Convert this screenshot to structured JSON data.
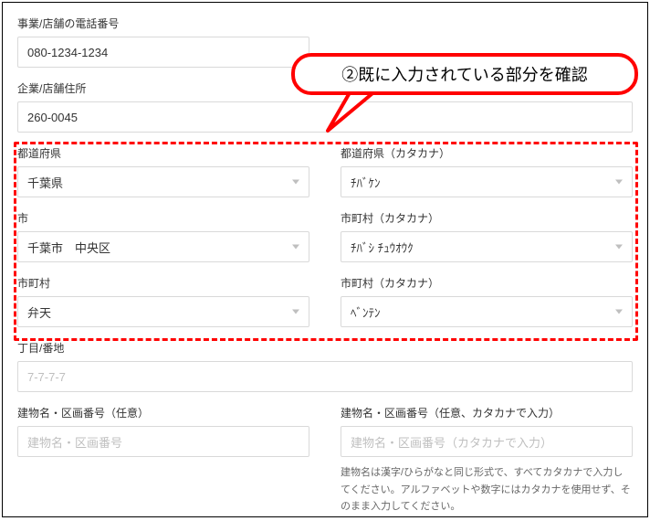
{
  "callout": {
    "text": "②既に入力されている部分を確認"
  },
  "phone": {
    "label": "事業/店舗の電話番号",
    "value": "080-1234-1234"
  },
  "address": {
    "label": "企業/店舗住所",
    "value": "260-0045"
  },
  "prefecture": {
    "label": "都道府県",
    "value": "千葉県"
  },
  "prefecture_kana": {
    "label": "都道府県（カタカナ）",
    "value": "ﾁﾊﾞｹﾝ"
  },
  "city": {
    "label": "市",
    "value": "千葉市　中央区"
  },
  "city_kana": {
    "label": "市町村（カタカナ）",
    "value": "ﾁﾊﾞｼ ﾁｭｳｵｳｸ"
  },
  "town": {
    "label": "市町村",
    "value": "弁天"
  },
  "town_kana": {
    "label": "市町村（カタカナ）",
    "value": "ﾍﾞﾝﾃﾝ"
  },
  "block": {
    "label": "丁目/番地",
    "placeholder": "7-7-7-7"
  },
  "building": {
    "label": "建物名・区画番号（任意）",
    "placeholder": "建物名・区画番号"
  },
  "building_kana": {
    "label": "建物名・区画番号（任意、カタカナで入力）",
    "placeholder": "建物名・区画番号（カタカナで入力）",
    "hint": "建物名は漢字/ひらがなと同じ形式で、すべてカタカナで入力してください。アルファベットや数字にはカタカナを使用せず、そのまま入力してください。"
  }
}
